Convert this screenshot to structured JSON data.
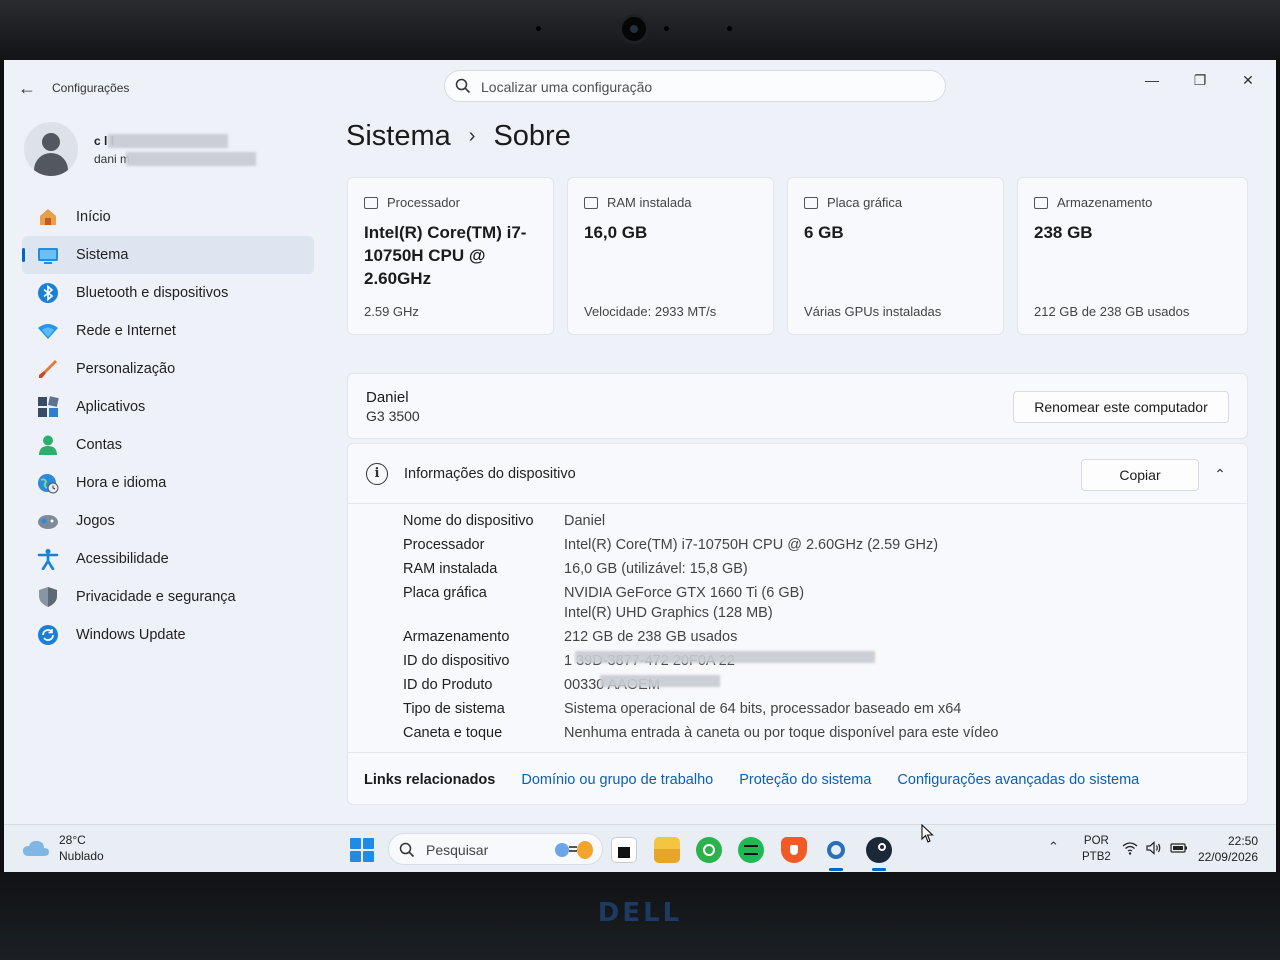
{
  "window": {
    "app_title": "Configurações",
    "search_placeholder": "Localizar uma configuração",
    "minimize_glyph": "—",
    "maximize_glyph": "❐",
    "close_glyph": "✕"
  },
  "user": {
    "name": "c    l l    ",
    "email": "dani          m"
  },
  "sidebar": {
    "items": [
      {
        "label": "Início",
        "icon": "home-icon",
        "active": false
      },
      {
        "label": "Sistema",
        "icon": "system-icon",
        "active": true
      },
      {
        "label": "Bluetooth e dispositivos",
        "icon": "bluetooth-icon",
        "active": false
      },
      {
        "label": "Rede e Internet",
        "icon": "wifi-icon",
        "active": false
      },
      {
        "label": "Personalização",
        "icon": "brush-icon",
        "active": false
      },
      {
        "label": "Aplicativos",
        "icon": "apps-icon",
        "active": false
      },
      {
        "label": "Contas",
        "icon": "account-icon",
        "active": false
      },
      {
        "label": "Hora e idioma",
        "icon": "globe-clock-icon",
        "active": false
      },
      {
        "label": "Jogos",
        "icon": "gamepad-icon",
        "active": false
      },
      {
        "label": "Acessibilidade",
        "icon": "accessibility-icon",
        "active": false
      },
      {
        "label": "Privacidade e segurança",
        "icon": "shield-icon",
        "active": false
      },
      {
        "label": "Windows Update",
        "icon": "update-icon",
        "active": false
      }
    ]
  },
  "breadcrumb": {
    "parent": "Sistema",
    "separator": "›",
    "current": "Sobre"
  },
  "summary_cards": [
    {
      "title": "Processador",
      "value": "Intel(R) Core(TM) i7-10750H CPU @ 2.60GHz",
      "sub": "2.59 GHz",
      "icon": "processor-icon"
    },
    {
      "title": "RAM instalada",
      "value": "16,0 GB",
      "sub": "Velocidade: 2933 MT/s",
      "icon": "ram-icon"
    },
    {
      "title": "Placa gráfica",
      "value": "6 GB",
      "sub": "Várias GPUs instaladas",
      "icon": "gpu-icon"
    },
    {
      "title": "Armazenamento",
      "value": "238 GB",
      "sub": "212 GB de 238 GB usados",
      "icon": "storage-icon"
    }
  ],
  "device": {
    "name": "Daniel",
    "model": "G3 3500",
    "rename_button": "Renomear este computador"
  },
  "device_info": {
    "title": "Informações do dispositivo",
    "copy_button": "Copiar",
    "chevron_glyph": "⌃",
    "rows": [
      {
        "key": "Nome do dispositivo",
        "value": "Daniel"
      },
      {
        "key": "Processador",
        "value": "Intel(R) Core(TM) i7-10750H CPU @ 2.60GHz (2.59 GHz)"
      },
      {
        "key": "RAM instalada",
        "value": "16,0 GB (utilizável: 15,8 GB)"
      },
      {
        "key": "Placa gráfica",
        "value": "NVIDIA GeForce GTX 1660 Ti (6 GB)\nIntel(R) UHD Graphics (128 MB)"
      },
      {
        "key": "Armazenamento",
        "value": "212 GB de 238 GB usados"
      },
      {
        "key": "ID do dispositivo",
        "value": "1       39D-3877-472        20F0A         22"
      },
      {
        "key": "ID do Produto",
        "value": "00330               AAOEM"
      },
      {
        "key": "Tipo de sistema",
        "value": "Sistema operacional de 64 bits, processador baseado em x64"
      },
      {
        "key": "Caneta e toque",
        "value": "Nenhuma entrada à caneta ou por toque disponível para este vídeo"
      }
    ]
  },
  "related_links": {
    "label": "Links relacionados",
    "links": [
      "Domínio ou grupo de trabalho",
      "Proteção do sistema",
      "Configurações avançadas do sistema"
    ]
  },
  "taskbar": {
    "weather_temp": "28°C",
    "weather_desc": "Nublado",
    "search_label": "Pesquisar",
    "apps": [
      "terminal-icon",
      "file-explorer-icon",
      "whatsapp-icon",
      "spotify-icon",
      "brave-icon",
      "settings-icon",
      "steam-icon"
    ],
    "lang_top": "POR",
    "lang_bottom": "PTB2",
    "time": "22:50",
    "date": "22/09/2026",
    "tray_chevron": "⌃"
  },
  "colors": {
    "accent": "#0067c0",
    "link": "#0c5fb3",
    "background": "#eef1f7",
    "card": "#f8f9fc"
  },
  "bezel": {
    "brand": "DELL"
  }
}
